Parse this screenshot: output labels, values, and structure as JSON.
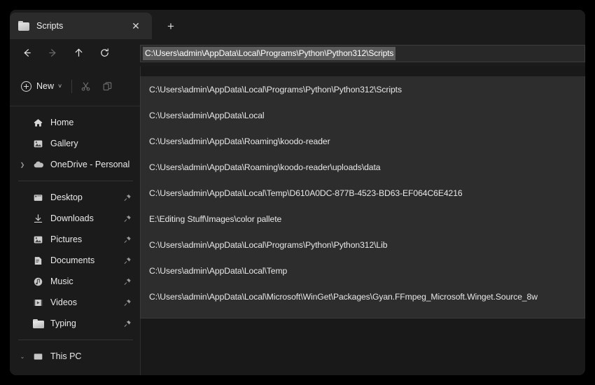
{
  "window": {
    "tab": {
      "title": "Scripts",
      "folder_icon": "folder-icon",
      "close_icon": "✕"
    },
    "new_tab_icon": "+"
  },
  "navbar": {
    "back_icon": "arrow-left-icon",
    "forward_icon": "arrow-right-icon",
    "up_icon": "arrow-up-icon",
    "refresh_icon": "refresh-icon"
  },
  "address": {
    "value": "C:\\Users\\admin\\AppData\\Local\\Programs\\Python\\Python312\\Scripts",
    "selection_color": "#5c5c5c"
  },
  "commandbar": {
    "new_label": "New",
    "new_chevron": "˅",
    "cut_icon": "scissors-icon",
    "copy_icon": "copy-icon"
  },
  "sidebar": {
    "items": [
      {
        "label": "Home",
        "icon": "home-icon",
        "expander": "",
        "pin": false
      },
      {
        "label": "Gallery",
        "icon": "gallery-icon",
        "expander": "",
        "pin": false
      },
      {
        "label": "OneDrive - Personal",
        "icon": "cloud-icon",
        "expander": "❯",
        "pin": false
      }
    ],
    "quick_access": [
      {
        "label": "Desktop",
        "icon": "desktop-icon",
        "pin": true
      },
      {
        "label": "Downloads",
        "icon": "download-icon",
        "pin": true
      },
      {
        "label": "Pictures",
        "icon": "pictures-icon",
        "pin": true
      },
      {
        "label": "Documents",
        "icon": "documents-icon",
        "pin": true
      },
      {
        "label": "Music",
        "icon": "music-icon",
        "pin": true
      },
      {
        "label": "Videos",
        "icon": "videos-icon",
        "pin": true
      },
      {
        "label": "Typing",
        "icon": "folder-icon",
        "pin": true
      }
    ],
    "bottom": [
      {
        "label": "This PC",
        "icon": "thispc-icon",
        "expander": "⌄",
        "pin": false
      }
    ]
  },
  "suggestions": [
    "C:\\Users\\admin\\AppData\\Local\\Programs\\Python\\Python312\\Scripts",
    "C:\\Users\\admin\\AppData\\Local",
    "C:\\Users\\admin\\AppData\\Roaming\\koodo-reader",
    "C:\\Users\\admin\\AppData\\Roaming\\koodo-reader\\uploads\\data",
    "C:\\Users\\admin\\AppData\\Local\\Temp\\D610A0DC-877B-4523-BD63-EF064C6E4216",
    "E:\\Editing Stuff\\Images\\color pallete",
    "C:\\Users\\admin\\AppData\\Local\\Programs\\Python\\Python312\\Lib",
    "C:\\Users\\admin\\AppData\\Local\\Temp",
    "C:\\Users\\admin\\AppData\\Local\\Microsoft\\WinGet\\Packages\\Gyan.FFmpeg_Microsoft.Winget.Source_8w"
  ]
}
